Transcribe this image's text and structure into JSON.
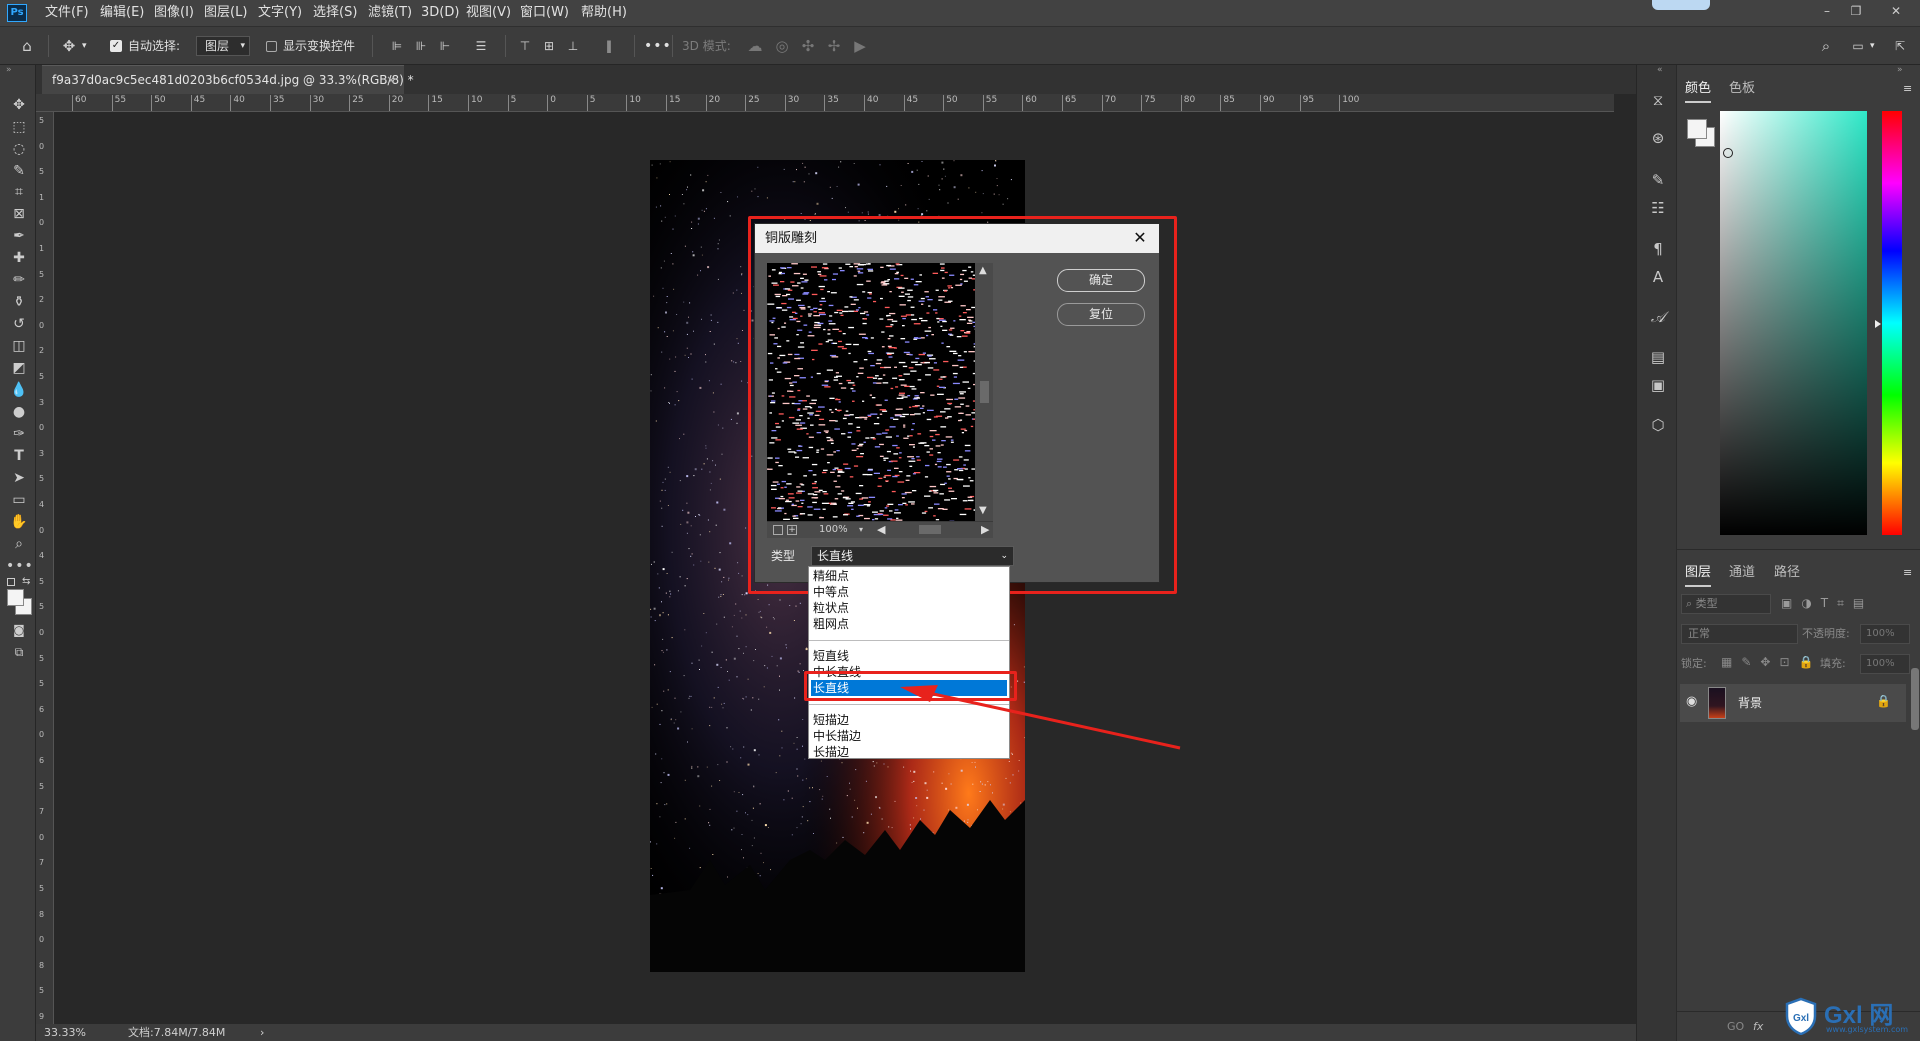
{
  "menubar": {
    "logo": "Ps",
    "items": [
      "文件(F)",
      "编辑(E)",
      "图像(I)",
      "图层(L)",
      "文字(Y)",
      "选择(S)",
      "滤镜(T)",
      "3D(D)",
      "视图(V)",
      "窗口(W)",
      "帮助(H)"
    ],
    "window_buttons": [
      "–",
      "❐",
      "✕"
    ]
  },
  "options_bar": {
    "auto_select_label": "自动选择:",
    "auto_select_checked": true,
    "auto_select_value": "图层",
    "show_transform_label": "显示变换控件",
    "show_transform_checked": false,
    "mode_3d_label": "3D 模式:",
    "more_label": "•••"
  },
  "document": {
    "tab_title": "f9a37d0ac9c5ec481d0203b6cf0534d.jpg @ 33.3%(RGB/8) *",
    "tab_close": "×",
    "ruler_h_ticks": [
      "60",
      "55",
      "50",
      "45",
      "40",
      "35",
      "30",
      "25",
      "20",
      "15",
      "10",
      "5",
      "0",
      "5",
      "10",
      "15",
      "20",
      "25",
      "30",
      "35",
      "40",
      "45",
      "50",
      "55",
      "60",
      "65",
      "70",
      "75",
      "80",
      "85",
      "90",
      "95",
      "100"
    ],
    "ruler_v_ticks": [
      "5",
      "0",
      "5",
      "1",
      "0",
      "1",
      "5",
      "2",
      "0",
      "2",
      "5",
      "3",
      "0",
      "3",
      "5",
      "4",
      "0",
      "4",
      "5",
      "5",
      "0",
      "5",
      "5",
      "6",
      "0",
      "6",
      "5",
      "7",
      "0",
      "7",
      "5",
      "8",
      "0",
      "8",
      "5",
      "9"
    ]
  },
  "statusbar": {
    "zoom": "33.33%",
    "doc_info": "文档:7.84M/7.84M",
    "arrow": "›"
  },
  "dialog": {
    "title": "铜版雕刻",
    "ok_label": "确定",
    "reset_label": "复位",
    "zoom_value": "100%",
    "type_label": "类型",
    "type_value": "长直线",
    "dropdown_groups": [
      [
        "精细点",
        "中等点",
        "粒状点",
        "粗网点"
      ],
      [
        "短直线",
        "中长直线",
        "长直线"
      ],
      [
        "短描边",
        "中长描边",
        "长描边"
      ]
    ],
    "selected_option": "长直线"
  },
  "color_panel": {
    "tabs": [
      "颜色",
      "色板"
    ],
    "hue_accent": "#2ee8c8"
  },
  "layers_panel": {
    "tabs": [
      "图层",
      "通道",
      "路径"
    ],
    "filter_placeholder": "类型",
    "blend_mode": "正常",
    "opacity_label": "不透明度:",
    "opacity_value": "100%",
    "lock_label": "锁定:",
    "fill_label": "填充:",
    "fill_value": "100%",
    "layer_name": "背景",
    "bottom_icons": [
      "GO",
      "fx"
    ]
  },
  "watermark": {
    "brand": "Gxl 网",
    "url": "www.gxlsystem.com"
  },
  "colors": {
    "highlight_blue": "#0078d7",
    "annotation_red": "#e8221c",
    "panel_bg": "#3c3c3c",
    "canvas_bg": "#282828"
  }
}
